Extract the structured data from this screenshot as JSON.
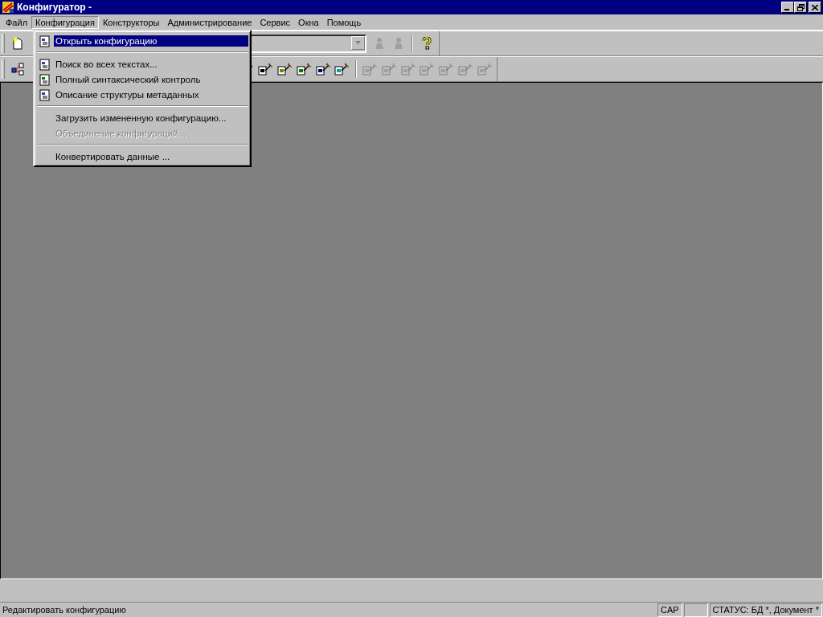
{
  "window": {
    "title": "Конфигуратор -"
  },
  "menu_bar": [
    {
      "label": "Файл",
      "selected": false
    },
    {
      "label": "Конфигурация",
      "selected": true
    },
    {
      "label": "Конструкторы",
      "selected": false
    },
    {
      "label": "Администрирование",
      "selected": false
    },
    {
      "label": "Сервис",
      "selected": false
    },
    {
      "label": "Окна",
      "selected": false
    },
    {
      "label": "Помощь",
      "selected": false
    }
  ],
  "dropdown": [
    {
      "kind": "icon_item",
      "label": "Открыть конфигурацию",
      "selected": true,
      "disabled": false
    },
    {
      "kind": "separator"
    },
    {
      "kind": "icon_item",
      "label": "Поиск во всех текстах...",
      "selected": false,
      "disabled": false
    },
    {
      "kind": "icon_item",
      "label": "Полный синтаксический контроль",
      "selected": false,
      "disabled": false
    },
    {
      "kind": "icon_item",
      "label": "Описание структуры метаданных",
      "selected": false,
      "disabled": false
    },
    {
      "kind": "separator"
    },
    {
      "kind": "item",
      "label": "Загрузить измененную конфигурацию...",
      "selected": false,
      "disabled": false
    },
    {
      "kind": "item",
      "label": "Объединение конфигураций...",
      "selected": false,
      "disabled": true
    },
    {
      "kind": "separator"
    },
    {
      "kind": "item",
      "label": "Конвертировать данные ...",
      "selected": false,
      "disabled": false
    }
  ],
  "toolbar_1": {
    "right_buttons": [
      {
        "disabled": true
      },
      {
        "disabled": true
      }
    ]
  },
  "toolbar_2": {
    "wizard_buttons": [
      {
        "disabled": false
      },
      {
        "disabled": false
      },
      {
        "disabled": false
      },
      {
        "disabled": false
      },
      {
        "disabled": false
      },
      {
        "disabled": false
      },
      {
        "disabled": true
      },
      {
        "disabled": true
      },
      {
        "disabled": true
      },
      {
        "disabled": true
      },
      {
        "disabled": true
      },
      {
        "disabled": true
      },
      {
        "disabled": true
      }
    ]
  },
  "status_bar": {
    "message": "Редактировать конфигурацию",
    "indicators": [
      "CAP",
      "СТАТУС: БД *, Документ *"
    ]
  }
}
